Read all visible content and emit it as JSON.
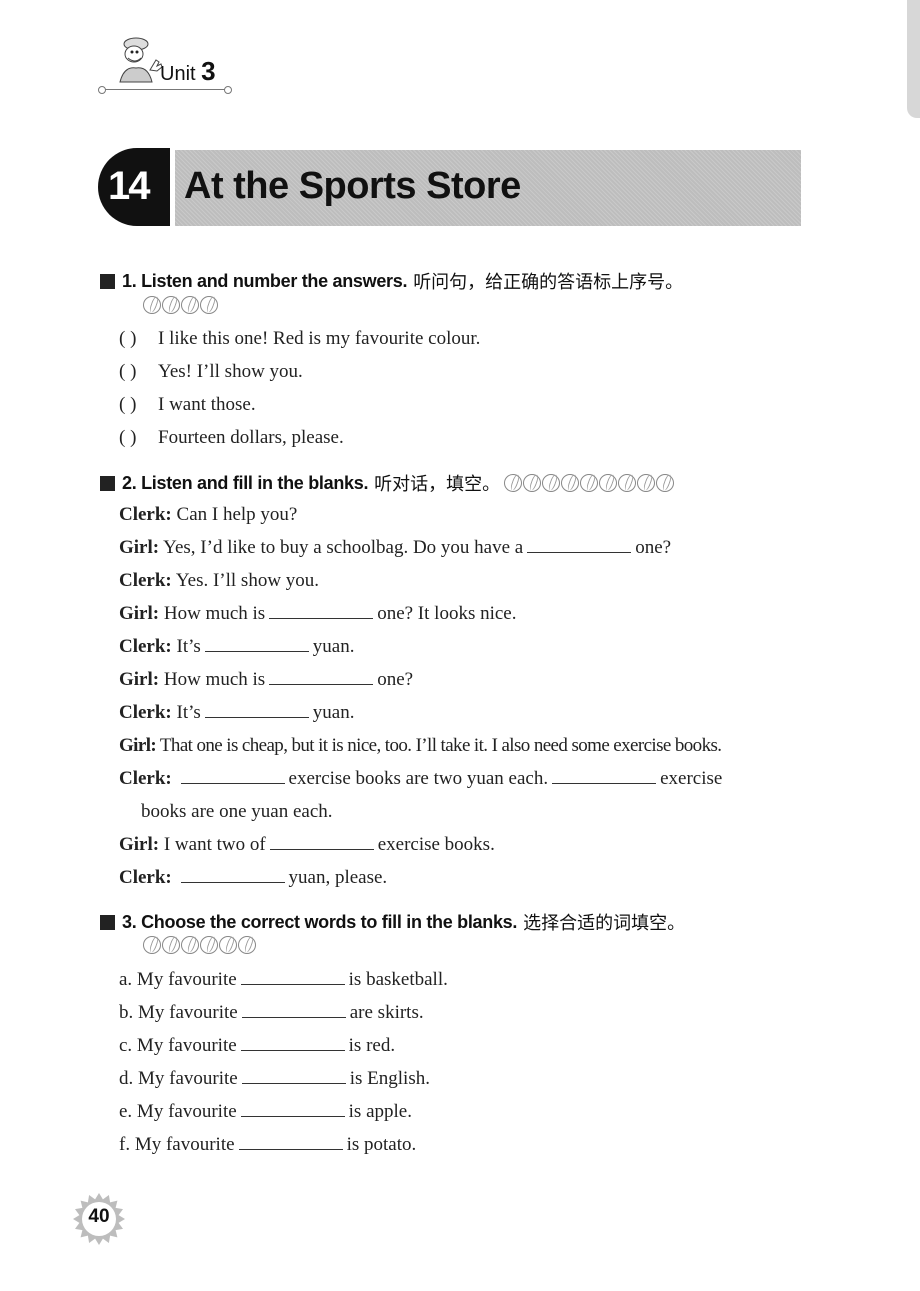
{
  "unit_header": {
    "label": "Unit",
    "number": "3"
  },
  "lesson": {
    "number": "14",
    "title": "At the Sports Store"
  },
  "sections": [
    {
      "heading_en": "1. Listen and number the answers.",
      "heading_zh": "听问句，给正确的答语标上序号。",
      "ball_count": 4,
      "items": [
        {
          "paren": "(     )",
          "text": "I like this one! Red is my favourite colour."
        },
        {
          "paren": "(     )",
          "text": "Yes! I’ll show you."
        },
        {
          "paren": "(     )",
          "text": "I want those."
        },
        {
          "paren": "(     )",
          "text": "Fourteen dollars, please."
        }
      ]
    },
    {
      "heading_en": "2. Listen and fill in the blanks.",
      "heading_zh": "听对话，填空。",
      "ball_count": 9,
      "dialogue": [
        {
          "speaker": "Clerk:",
          "parts": [
            "Can I help you?"
          ]
        },
        {
          "speaker": "Girl:",
          "parts": [
            "Yes, I’d like to buy a schoolbag. Do you have a",
            "one?"
          ]
        },
        {
          "speaker": "Clerk:",
          "parts": [
            "Yes. I’ll show you."
          ]
        },
        {
          "speaker": "Girl:",
          "parts": [
            "How much is",
            "one? It looks nice."
          ]
        },
        {
          "speaker": "Clerk:",
          "parts": [
            "It’s",
            "yuan."
          ]
        },
        {
          "speaker": "Girl:",
          "parts": [
            "How much is",
            "one?"
          ]
        },
        {
          "speaker": "Clerk:",
          "parts": [
            "It’s",
            "yuan."
          ]
        },
        {
          "speaker": "Girl:",
          "parts": [
            "That one is cheap, but it is nice, too. I’ll take it. I also need some exercise books."
          ]
        },
        {
          "speaker": "Clerk:",
          "parts": [
            "",
            "exercise books are two yuan each.",
            "exercise"
          ],
          "continuation": "books are one yuan each."
        },
        {
          "speaker": "Girl:",
          "parts": [
            "I want two of",
            "exercise books."
          ]
        },
        {
          "speaker": "Clerk:",
          "parts": [
            "",
            "yuan, please."
          ]
        }
      ]
    },
    {
      "heading_en": "3. Choose the correct words to fill in the blanks.",
      "heading_zh": "选择合适的词填空。",
      "ball_count": 6,
      "items": [
        {
          "prefix": "a. My favourite",
          "suffix": "is basketball."
        },
        {
          "prefix": "b. My favourite",
          "suffix": "are skirts."
        },
        {
          "prefix": "c. My favourite",
          "suffix": "is red."
        },
        {
          "prefix": "d. My favourite",
          "suffix": "is English."
        },
        {
          "prefix": "e. My favourite",
          "suffix": "is apple."
        },
        {
          "prefix": "f. My favourite",
          "suffix": "is potato."
        }
      ]
    }
  ],
  "page_number": "40"
}
